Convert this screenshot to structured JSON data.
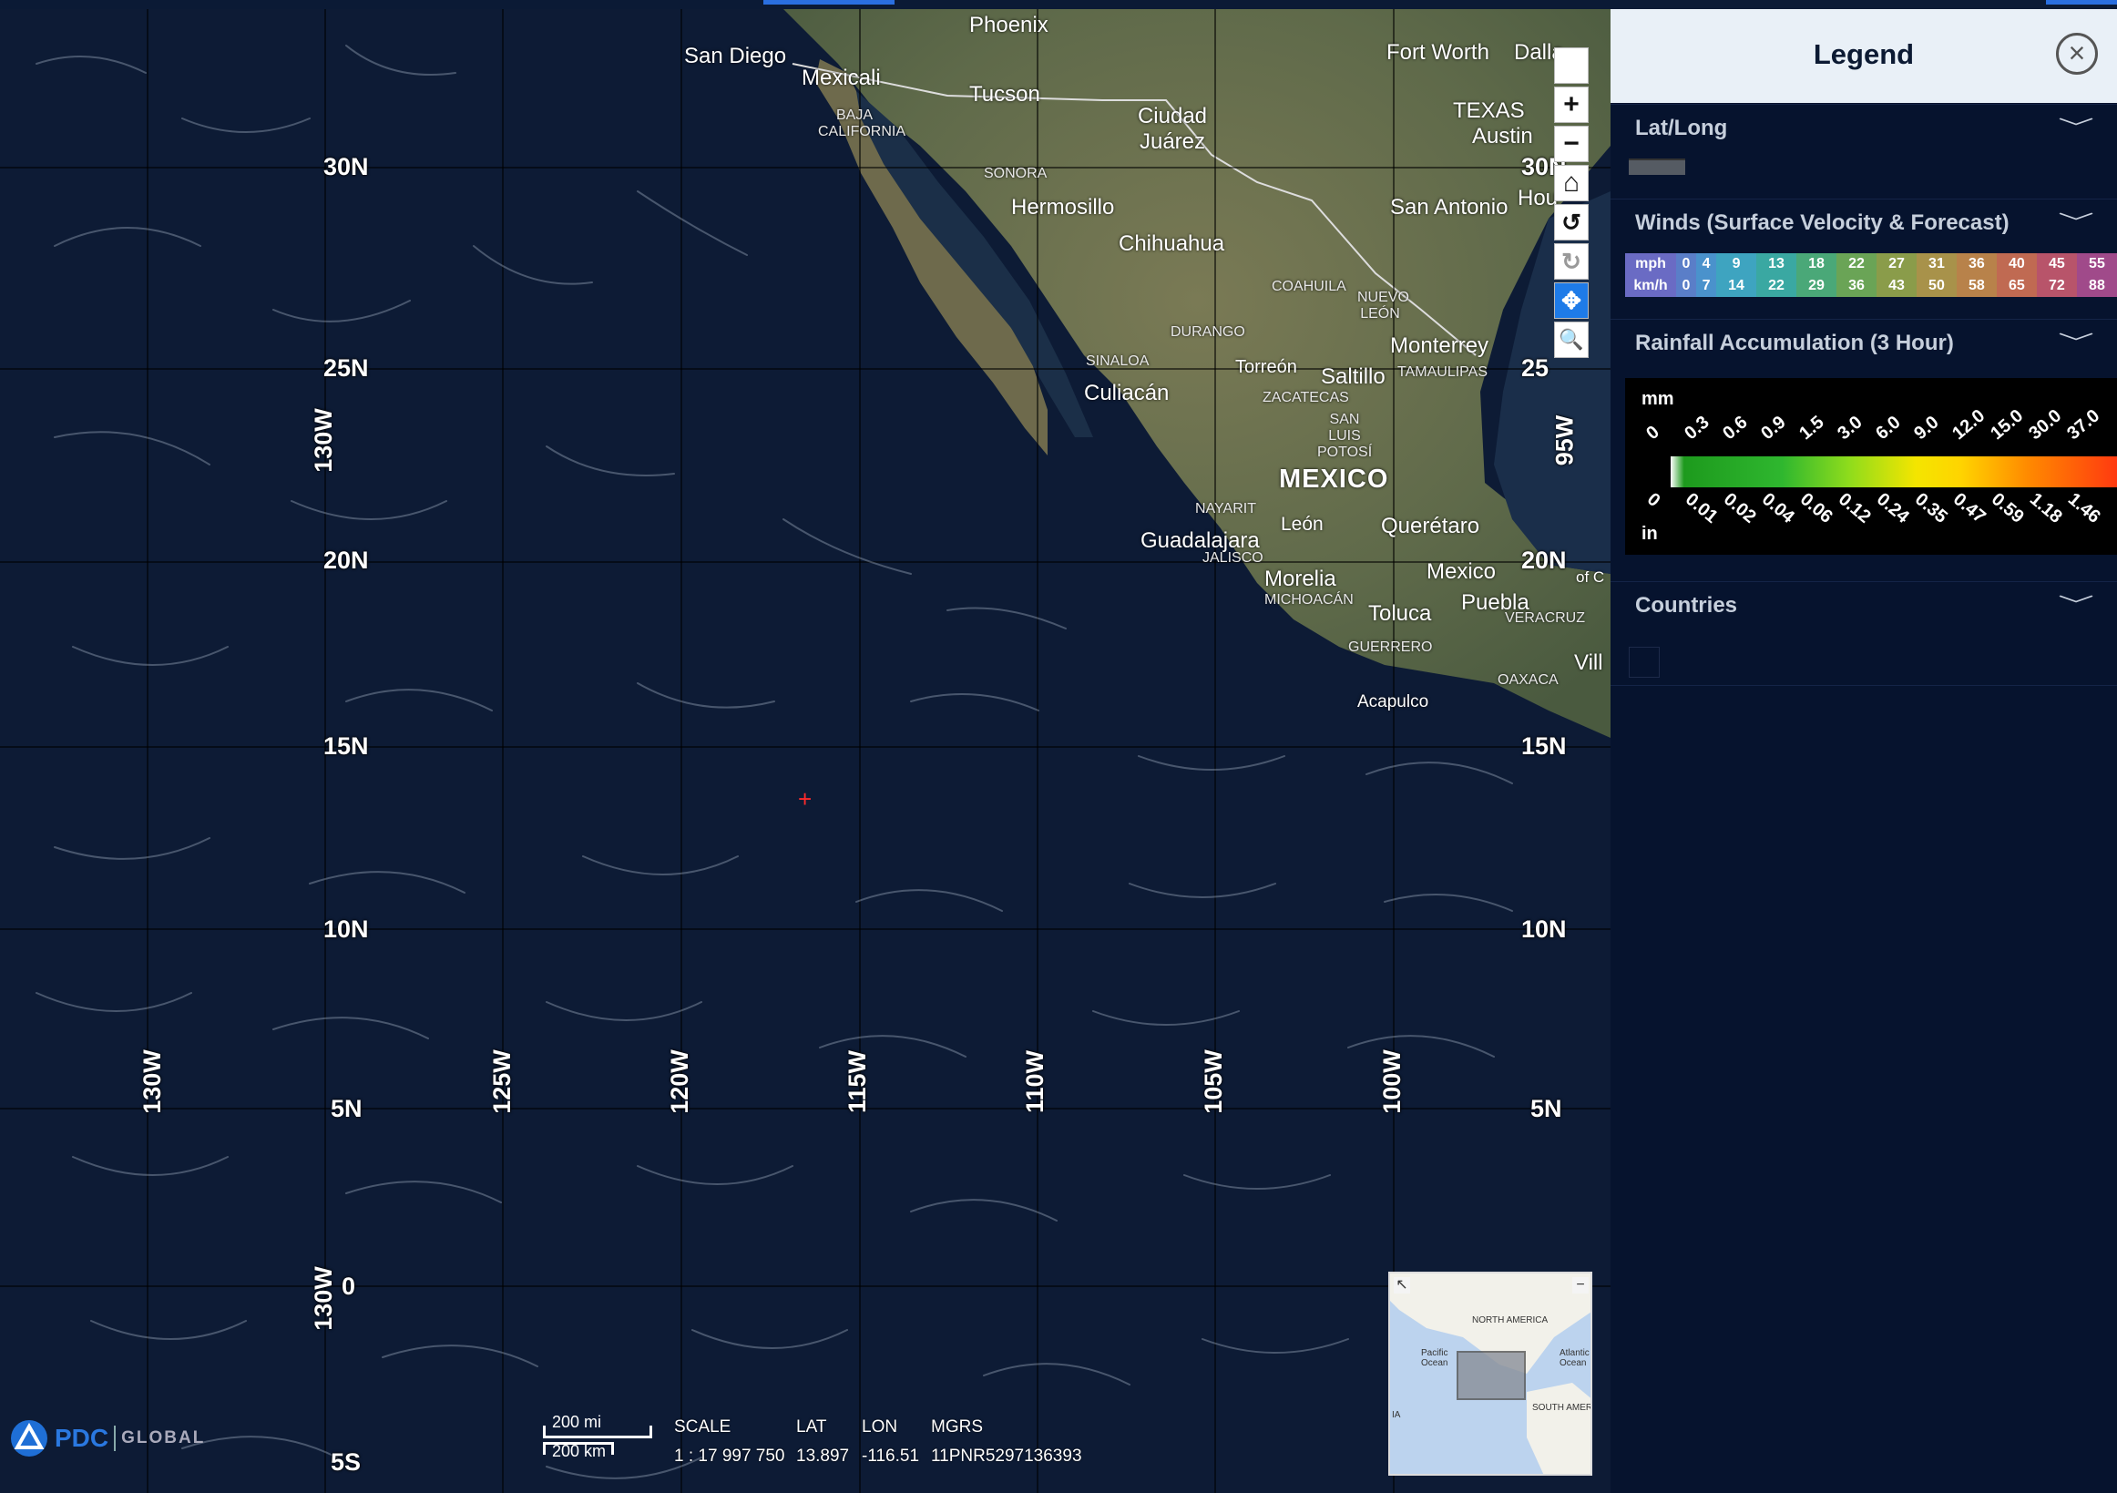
{
  "topbar": {
    "segments": [
      {
        "color": "#2a6fe0"
      },
      {
        "color": "#2a6fe0"
      }
    ]
  },
  "map": {
    "lat_labels": [
      {
        "text": "30N"
      },
      {
        "text": "25N"
      },
      {
        "text": "20N"
      },
      {
        "text": "15N"
      },
      {
        "text": "10N"
      },
      {
        "text": "5N"
      },
      {
        "text": "0"
      },
      {
        "text": "5S"
      }
    ],
    "lat_labels_right": [
      {
        "text": "30N"
      },
      {
        "text": "25"
      },
      {
        "text": "20N"
      },
      {
        "text": "15N"
      },
      {
        "text": "10N"
      },
      {
        "text": "5N"
      }
    ],
    "lon_labels": [
      {
        "text": "130W"
      },
      {
        "text": "125W"
      },
      {
        "text": "120W"
      },
      {
        "text": "115W"
      },
      {
        "text": "110W"
      },
      {
        "text": "105W"
      },
      {
        "text": "100W"
      }
    ],
    "lon_labels_extra": [
      {
        "text": "130W"
      },
      {
        "text": "130W"
      },
      {
        "text": "95W"
      }
    ],
    "cities": [
      "Phoenix",
      "San Diego",
      "Mexicali",
      "Tucson",
      "Fort Worth",
      "Dalla",
      "TEXAS",
      "Austin",
      "Ciudad Juárez",
      "Hermosillo",
      "Chihuahua",
      "San Antonio",
      "Hou",
      "Monterrey",
      "Torreón",
      "Saltillo",
      "Culiacán",
      "MEXICO",
      "León",
      "Querétaro",
      "Guadalajara",
      "Morelia",
      "Toluca",
      "Mexico",
      "Puebla",
      "Acapulco",
      "Vill",
      "of C"
    ],
    "states": [
      "BAJA CALIFORNIA",
      "SONORA",
      "COAHUILA",
      "NUEVO LEÓN",
      "DURANGO",
      "SINALOA",
      "ZACATECAS",
      "TAMAULIPAS",
      "SAN LUIS POTOSÍ",
      "NAYARIT",
      "JALISCO",
      "MICHOACÁN",
      "GUERRERO",
      "VERACRUZ",
      "OAXACA"
    ],
    "toolbar": {
      "blank": "",
      "zoom_in": "+",
      "zoom_out": "−",
      "home": "⌂",
      "undo": "↺",
      "redo": "↻",
      "pan": "✥",
      "zoom_box": "🔍"
    },
    "crosshair": "+",
    "overview": {
      "labels": [
        "NORTH AMERICA",
        "Pacific Ocean",
        "Atlantic Ocean",
        "SOUTH AMERI",
        "IA"
      ],
      "expand": "↖",
      "collapse": "−"
    },
    "logo": {
      "brand": "PDC",
      "suffix": "GLOBAL"
    },
    "scale": {
      "mi": "200 mi",
      "km": "200 km"
    },
    "readout": {
      "scale_label": "SCALE",
      "scale_value": "1 : 17 997 750",
      "lat_label": "LAT",
      "lat_value": "13.897",
      "lon_label": "LON",
      "lon_value": "-116.51",
      "mgrs_label": "MGRS",
      "mgrs_value": "11PNR5297136393"
    }
  },
  "legend": {
    "title": "Legend",
    "close_icon": "×",
    "sections": {
      "latlong": "Lat/Long",
      "winds": "Winds (Surface Velocity & Forecast)",
      "rain": "Rainfall Accumulation (3 Hour)",
      "countries": "Countries"
    },
    "winds": {
      "row1_label": "mph",
      "row1": [
        "0",
        "4",
        "9",
        "13",
        "18",
        "22",
        "27",
        "31",
        "36",
        "40",
        "45",
        "55"
      ],
      "row2_label": "km/h",
      "row2": [
        "0",
        "7",
        "14",
        "22",
        "29",
        "36",
        "43",
        "50",
        "58",
        "65",
        "72",
        "88"
      ],
      "colors": [
        "#6a6bc4",
        "#5a86cc",
        "#4a9ccc",
        "#3aa6b8",
        "#3aa89a",
        "#5aa86c",
        "#7aa24a",
        "#9a9a4a",
        "#b2904a",
        "#c07a4a",
        "#c0605a",
        "#b04a6a",
        "#a04a8a"
      ]
    },
    "rain": {
      "unit_top": "mm",
      "unit_bottom": "in",
      "mm": [
        "0",
        "0.3",
        "0.6",
        "0.9",
        "1.5",
        "3.0",
        "6.0",
        "9.0",
        "12.0",
        "15.0",
        "30.0",
        "37.0"
      ],
      "in": [
        "0",
        "0.01",
        "0.02",
        "0.04",
        "0.06",
        "0.12",
        "0.24",
        "0.35",
        "0.47",
        "0.59",
        "1.18",
        "1.46"
      ]
    }
  }
}
